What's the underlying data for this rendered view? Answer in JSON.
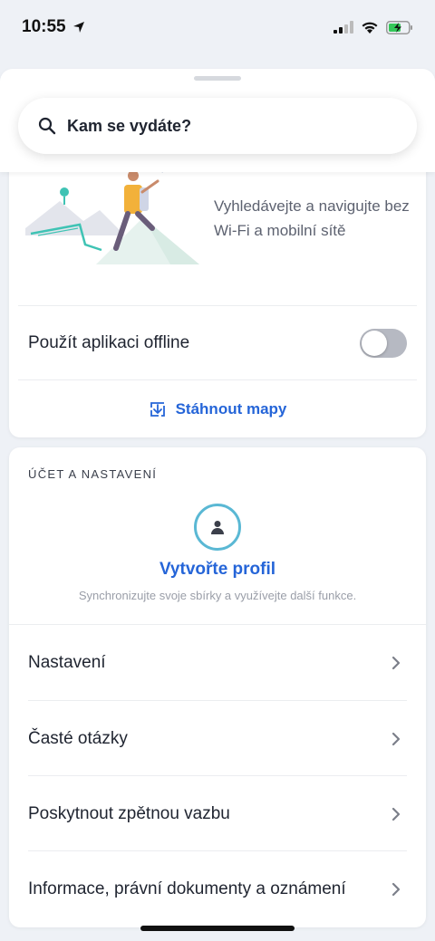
{
  "status_bar": {
    "time": "10:55",
    "icons": [
      "location-arrow-icon",
      "cellular-signal-icon",
      "wifi-icon",
      "battery-charging-icon"
    ]
  },
  "search": {
    "placeholder": "Kam se vydáte?",
    "icon": "search-icon"
  },
  "offline": {
    "promo_text": "Vyhledávejte a navigujte bez Wi-Fi a mobilní sítě",
    "toggle_label": "Použít aplikaci offline",
    "toggle_on": false,
    "download_label": "Stáhnout mapy",
    "download_icon": "download-map-icon"
  },
  "account": {
    "section_title": "ÚČET A NASTAVENÍ",
    "profile_title": "Vytvořte profil",
    "profile_subtitle": "Synchronizujte svoje sbírky a využívejte další funkce.",
    "menu": [
      {
        "label": "Nastavení"
      },
      {
        "label": "Časté otázky"
      },
      {
        "label": "Poskytnout zpětnou vazbu"
      },
      {
        "label": "Informace, právní dokumenty a oznámení"
      }
    ]
  },
  "colors": {
    "accent": "#2565d8",
    "ring": "#5ab8d4",
    "background": "#eef1f6"
  }
}
